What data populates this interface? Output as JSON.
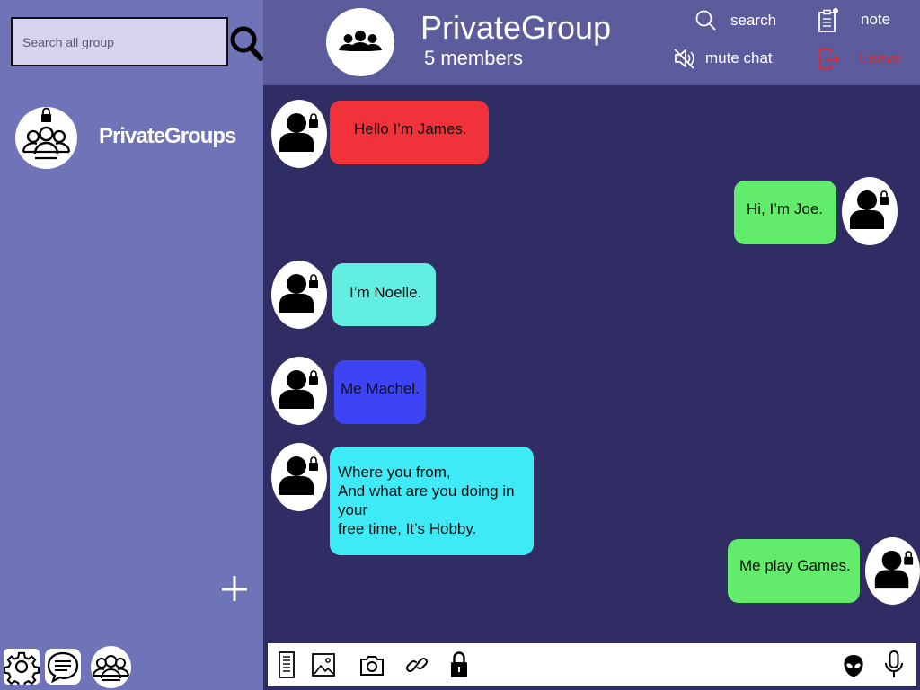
{
  "sidebar": {
    "search_placeholder": "Search all group",
    "group_name": "PrivateGroups"
  },
  "header": {
    "title": "PrivateGroup",
    "members": "5 members",
    "search_label": "search",
    "note_label": "note",
    "mute_label": "mute chat",
    "leave_label": "Leave"
  },
  "messages": [
    {
      "side": "left",
      "lines": [
        "Hello I’m James."
      ],
      "color": "#f2323a"
    },
    {
      "side": "right",
      "lines": [
        "Hi, I’m Joe."
      ],
      "color": "#63ec6b"
    },
    {
      "side": "left",
      "lines": [
        "I’m Noelle."
      ],
      "color": "#62efe2"
    },
    {
      "side": "left",
      "lines": [
        "Me Machel."
      ],
      "color": "#3c44f6"
    },
    {
      "side": "left",
      "lines": [
        "Where you from,",
        "And what are you doing in",
        "your",
        "free time, It’s Hobby."
      ],
      "color": "#3eeaf6"
    },
    {
      "side": "right",
      "lines": [
        "Me play Games."
      ],
      "color": "#63ec6b"
    }
  ],
  "colors": {
    "sidebar_bg": "#6f73b8",
    "header_bg": "#5c5c9c",
    "chat_bg": "#2f2d63",
    "leave": "#e8262e"
  }
}
